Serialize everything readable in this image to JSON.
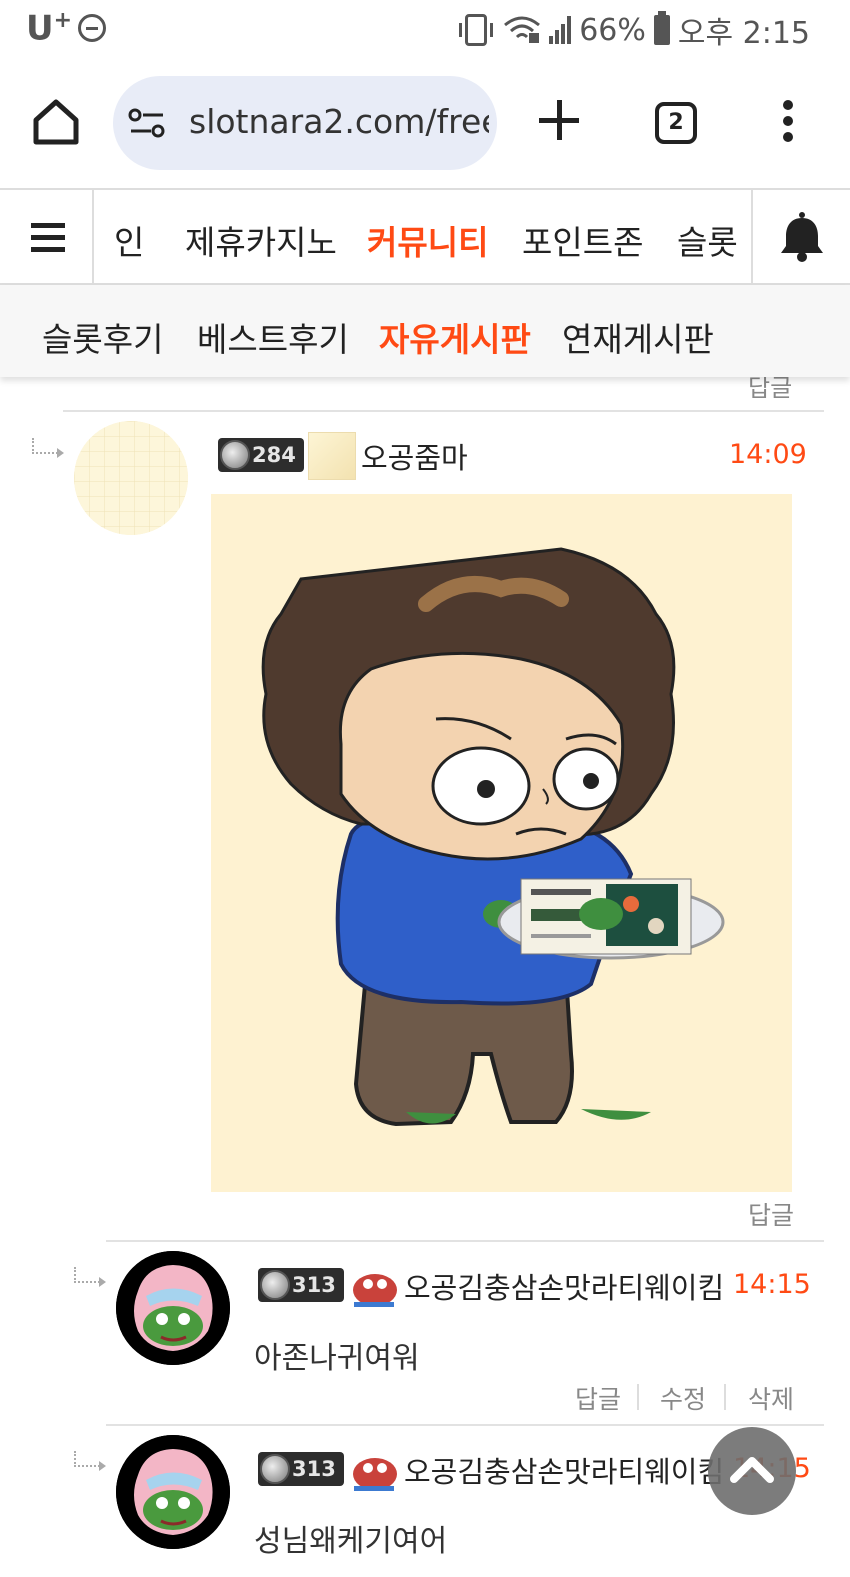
{
  "status_bar": {
    "carrier": "U",
    "carrier_sup": "+",
    "battery": "66%",
    "time": "오후 2:15"
  },
  "browser": {
    "url": "slotnara2.com/free",
    "tab_count": "2"
  },
  "site_nav": {
    "items": [
      {
        "label": "인"
      },
      {
        "label": "제휴카지노"
      },
      {
        "label": "커뮤니티",
        "active": true
      },
      {
        "label": "포인트존"
      },
      {
        "label": "슬롯"
      }
    ]
  },
  "sub_nav": {
    "items": [
      {
        "label": "슬롯후기"
      },
      {
        "label": "베스트후기"
      },
      {
        "label": "자유게시판",
        "active": true
      },
      {
        "label": "연재게시판"
      }
    ]
  },
  "comments": [
    {
      "level": "284",
      "nickname": "오공줌마",
      "time": "14:09",
      "reply_label": "답글",
      "has_image": true
    },
    {
      "level": "313",
      "nickname": "오공김충삼손맛라티웨이킴",
      "time": "14:15",
      "text": "아존나귀여워",
      "actions": [
        "답글",
        "수정",
        "삭제"
      ]
    },
    {
      "level": "313",
      "nickname": "오공김충삼손맛라티웨이킴",
      "time": "14:15",
      "text": "성님왜케기여어"
    }
  ],
  "prev_reply_label": "답글",
  "accent_color": "#ff4a14"
}
